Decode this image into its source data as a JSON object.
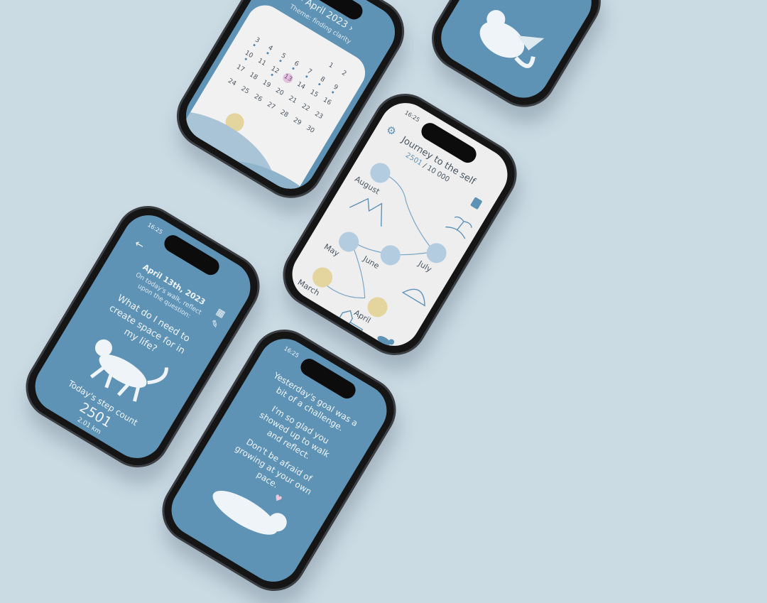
{
  "calendar": {
    "title": "April 2023",
    "theme": "Theme: finding clarity",
    "prev_icon": "chevron-left-icon",
    "next_icon": "chevron-right-icon",
    "days": [
      {
        "day": "",
        "dot": false
      },
      {
        "day": "",
        "dot": false
      },
      {
        "day": "",
        "dot": false
      },
      {
        "day": "",
        "dot": false
      },
      {
        "day": "",
        "dot": false
      },
      {
        "day": "1",
        "dot": false
      },
      {
        "day": "2",
        "dot": false
      },
      {
        "day": "3",
        "dot": true
      },
      {
        "day": "4",
        "dot": true
      },
      {
        "day": "5",
        "dot": true
      },
      {
        "day": "6",
        "dot": true
      },
      {
        "day": "7",
        "dot": true
      },
      {
        "day": "8",
        "dot": true
      },
      {
        "day": "9",
        "dot": true
      },
      {
        "day": "10",
        "dot": true
      },
      {
        "day": "11",
        "dot": false
      },
      {
        "day": "12",
        "dot": true
      },
      {
        "day": "13",
        "dot": false,
        "today": true
      },
      {
        "day": "14",
        "dot": false
      },
      {
        "day": "15",
        "dot": false
      },
      {
        "day": "16",
        "dot": false
      },
      {
        "day": "17",
        "dot": false
      },
      {
        "day": "18",
        "dot": false
      },
      {
        "day": "19",
        "dot": false
      },
      {
        "day": "20",
        "dot": false
      },
      {
        "day": "21",
        "dot": false
      },
      {
        "day": "22",
        "dot": false
      },
      {
        "day": "23",
        "dot": false
      },
      {
        "day": "24",
        "dot": false
      },
      {
        "day": "25",
        "dot": false
      },
      {
        "day": "26",
        "dot": false
      },
      {
        "day": "27",
        "dot": false
      },
      {
        "day": "28",
        "dot": false
      },
      {
        "day": "29",
        "dot": false
      },
      {
        "day": "30",
        "dot": false
      }
    ]
  },
  "journey": {
    "status_time": "16:25",
    "title": "Journey to the self",
    "progress_current": "2501",
    "progress_total": " / 10 000",
    "months": {
      "august": "August",
      "july": "July",
      "june": "June",
      "may": "May",
      "march": "March",
      "april": "April"
    },
    "icons": [
      "gear-icon",
      "book-icon",
      "palm-island-icon",
      "mountains-icon",
      "cave-icon",
      "castle-icon",
      "cat-icon"
    ]
  },
  "walk": {
    "status_time": "16:25",
    "date": "April 13th, 2023",
    "subtitle": "On today's walk, reflect upon the question:",
    "question": "What do I need to create space for in my life?",
    "steps_label": "Today's step count",
    "steps_count": "2501",
    "distance": "2.01 km",
    "icons": [
      "back-arrow-icon",
      "calendar-icon",
      "edit-icon",
      "cat-walking-illustration"
    ]
  },
  "message": {
    "status_time": "16:25",
    "lines": [
      "Yesterday's goal was a bit of a challenge.",
      "I'm so glad you showed up to walk and reflect.",
      "Don't be afraid of growing at your own pace."
    ],
    "icons": [
      "heart-icon",
      "cat-lying-illustration"
    ]
  },
  "dragon": {
    "icons": [
      "dragon-illustration"
    ]
  },
  "colors": {
    "background": "#cbdbe4",
    "screen_blue": "#5f93b5",
    "node_blue": "#b3ccdf",
    "node_gold": "#e4d49d",
    "today": "#e2c3dc"
  }
}
